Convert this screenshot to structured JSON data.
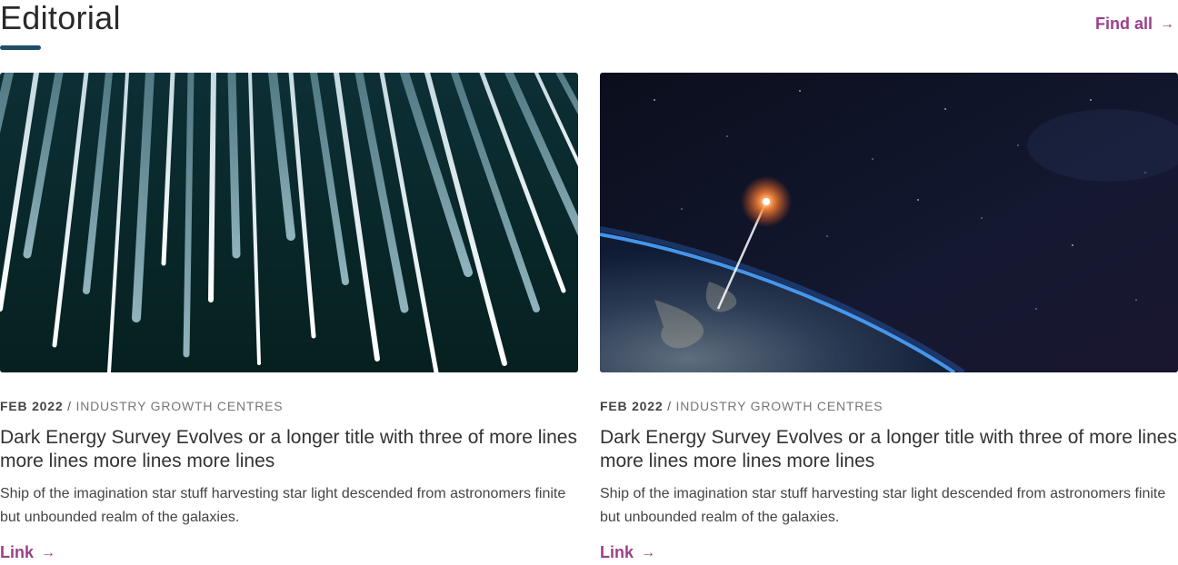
{
  "section": {
    "title": "Editorial",
    "find_all_label": "Find all",
    "arrow": "→"
  },
  "cards": [
    {
      "date": "FEB 2022",
      "separator": " / ",
      "category": "INDUSTRY GROWTH CENTRES",
      "title": "Dark Energy Survey Evolves or a longer title with three of more lines more lines more lines more lines",
      "description": "Ship of the imagination star stuff harvesting star light descended from astronomers finite but unbounded realm of the galaxies.",
      "link_label": "Link",
      "arrow": "→"
    },
    {
      "date": "FEB 2022",
      "separator": " / ",
      "category": "INDUSTRY GROWTH CENTRES",
      "title": "Dark Energy Survey Evolves or a longer title with three of more lines more lines more lines more lines",
      "description": "Ship of the imagination star stuff harvesting star light descended from astronomers finite but unbounded realm of the galaxies.",
      "link_label": "Link",
      "arrow": "→"
    }
  ],
  "colors": {
    "accent": "#9b3f88",
    "underline": "#1f4e68"
  }
}
